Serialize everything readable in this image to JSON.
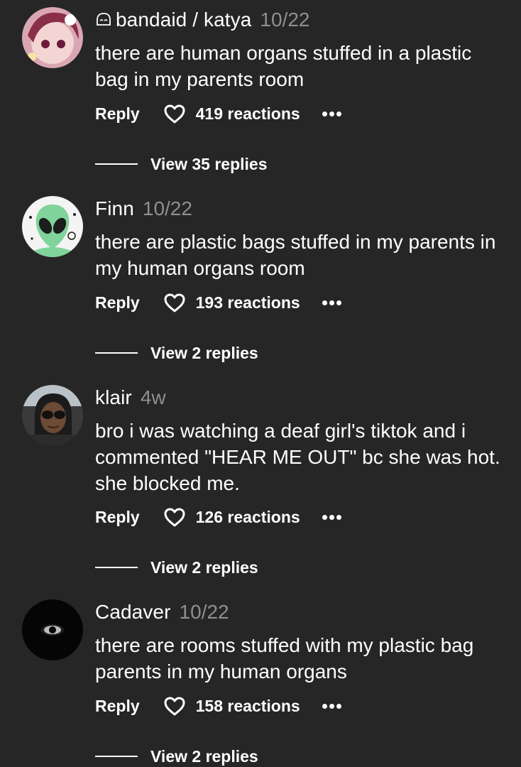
{
  "comments": [
    {
      "username": "bandaid / katya",
      "time": "10/22",
      "text": "there are human organs stuffed in a plastic bag in my parents room",
      "reply_label": "Reply",
      "reactions": "419 reactions",
      "view_replies": "View 35 replies"
    },
    {
      "username": "Finn",
      "time": "10/22",
      "text": "there are plastic bags stuffed in my parents in my human organs room",
      "reply_label": "Reply",
      "reactions": "193 reactions",
      "view_replies": "View 2 replies"
    },
    {
      "username": "klair",
      "time": "4w",
      "text": "bro i was watching a deaf girl's tiktok and i commented \"HEAR ME OUT\" bc she was hot. she blocked me.",
      "reply_label": "Reply",
      "reactions": "126 reactions",
      "view_replies": "View 2 replies"
    },
    {
      "username": "Cadaver",
      "time": "10/22",
      "text": "there are rooms stuffed with my plastic bag parents in my human organs",
      "reply_label": "Reply",
      "reactions": "158 reactions",
      "view_replies": "View 2 replies"
    }
  ],
  "icons": {
    "username_prefix": "emoticon-icon",
    "reaction": "heart-icon",
    "more": "more-dots-icon"
  },
  "colors": {
    "background": "#262626",
    "text": "#ffffff",
    "muted": "#8f8f8f",
    "alien_green": "#7fd39b"
  }
}
